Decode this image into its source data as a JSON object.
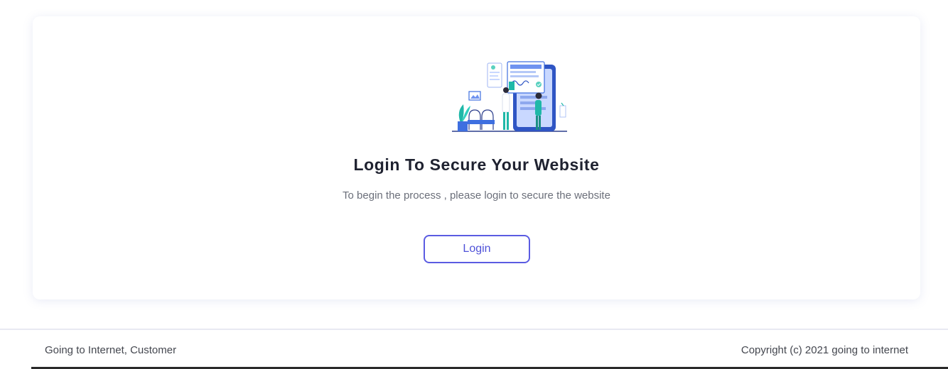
{
  "main": {
    "title": "Login To Secure Your Website",
    "subtitle": "To begin the process , please login to secure the website",
    "login_label": "Login"
  },
  "footer": {
    "left_text": "Going to Internet, Customer",
    "right_text": "Copyright (c) 2021 going to internet"
  },
  "colors": {
    "accent": "#5b5ce2",
    "illustration_blue": "#3e6fe0",
    "illustration_teal": "#1fb8a8"
  }
}
